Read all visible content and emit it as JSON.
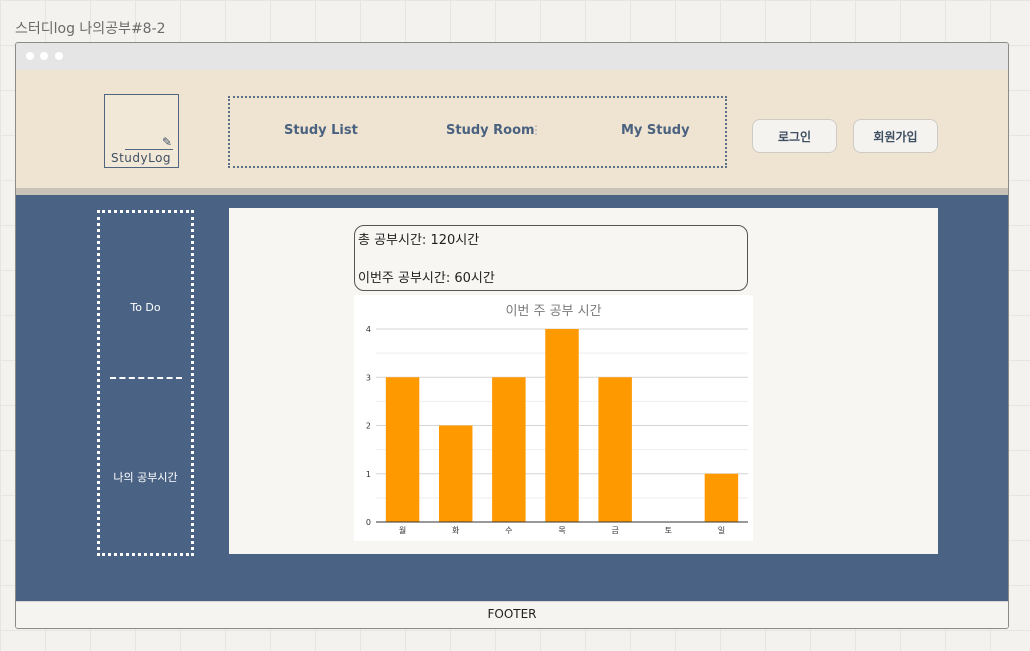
{
  "frame_title": "스터디log 나의공부#8-2",
  "logo": {
    "text": "StudyLog"
  },
  "nav": {
    "items": [
      "Study List",
      "Study Room",
      "My Study"
    ]
  },
  "auth": {
    "login": "로그인",
    "signup": "회원가입"
  },
  "sidebar": {
    "items": [
      "To Do",
      "나의 공부시간"
    ]
  },
  "summary": {
    "total": "총 공부시간: 120시간",
    "this_week": "이번주 공부시간: 60시간"
  },
  "footer": "FOOTER",
  "colors": {
    "bar": "#ff9900",
    "main_bg": "#4a6385",
    "header_bg": "#efe4d1"
  },
  "chart_data": {
    "type": "bar",
    "title": "이번 주 공부 시간",
    "categories": [
      "월",
      "화",
      "수",
      "목",
      "금",
      "토",
      "일"
    ],
    "values": [
      3,
      2,
      3,
      4,
      3,
      0,
      1
    ],
    "ylim": [
      0,
      4
    ],
    "yticks": [
      0,
      1,
      2,
      3,
      4
    ],
    "grid": true
  }
}
